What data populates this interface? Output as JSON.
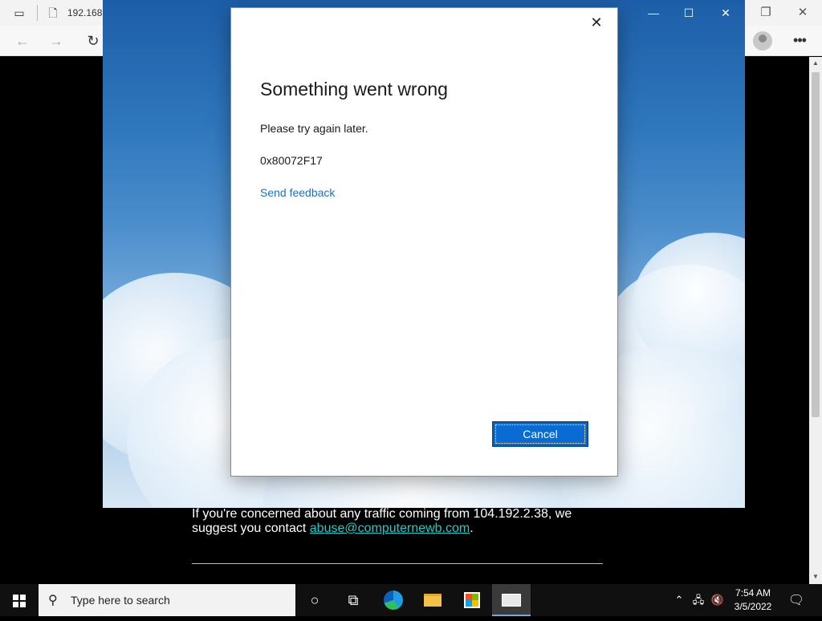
{
  "browser": {
    "url": "192.168.",
    "back_icon": "back-arrow-icon",
    "forward_icon": "forward-arrow-icon",
    "refresh_icon": "refresh-icon",
    "more_icon": "more-icon"
  },
  "page": {
    "concern_text": "If you're concerned about any traffic coming from 104.192.2.38, we suggest you contact ",
    "abuse_link": "abuse@computernewb.com",
    "period": "."
  },
  "dialog": {
    "title": "Something went wrong",
    "message": "Please try again later.",
    "error_code": "0x80072F17",
    "feedback_link": "Send feedback",
    "cancel_label": "Cancel",
    "close_glyph": "✕"
  },
  "taskbar": {
    "search_placeholder": "Type here to search",
    "time": "7:54 AM",
    "date": "3/5/2022"
  },
  "colors": {
    "accent": "#0a6bd2",
    "link": "#1a72c4",
    "page_link": "#22c9c4"
  }
}
